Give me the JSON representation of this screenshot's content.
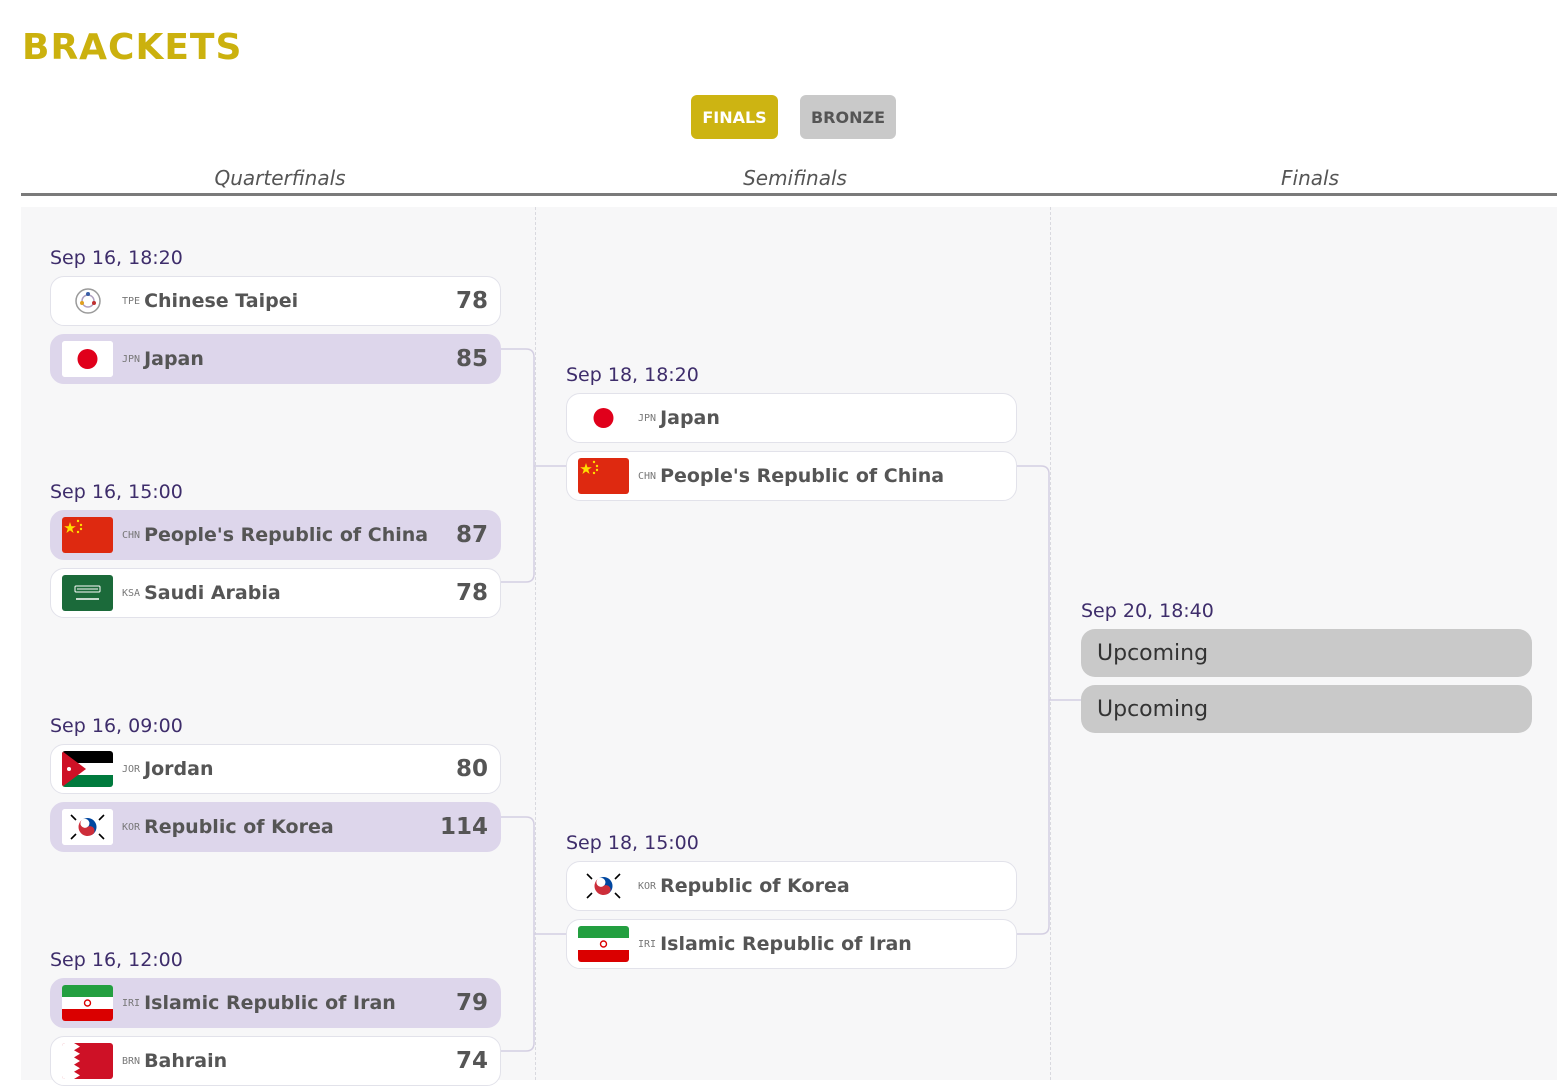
{
  "page": {
    "title": "BRACKETS"
  },
  "tabs": {
    "finals": "FINALS",
    "bronze": "BRONZE",
    "active": "FINALS"
  },
  "rounds": [
    "Quarterfinals",
    "Semifinals",
    "Finals"
  ],
  "colors": {
    "brand_gold": "#cdb412",
    "winner_highlight": "#ddd6eb",
    "date_text": "#3e2d6b",
    "upcoming_bg": "#c9c9c9"
  },
  "quarterfinals": [
    {
      "date": "Sep 16, 18:20",
      "teams": [
        {
          "code": "TPE",
          "name": "Chinese Taipei",
          "score": "78",
          "flag": "flag-chinese-taipei-icon",
          "winner": false
        },
        {
          "code": "JPN",
          "name": "Japan",
          "score": "85",
          "flag": "flag-japan-icon",
          "winner": true
        }
      ]
    },
    {
      "date": "Sep 16, 15:00",
      "teams": [
        {
          "code": "CHN",
          "name": "People's Republic of China",
          "score": "87",
          "flag": "flag-china-icon",
          "winner": true
        },
        {
          "code": "KSA",
          "name": "Saudi Arabia",
          "score": "78",
          "flag": "flag-saudi-arabia-icon",
          "winner": false
        }
      ]
    },
    {
      "date": "Sep 16, 09:00",
      "teams": [
        {
          "code": "JOR",
          "name": "Jordan",
          "score": "80",
          "flag": "flag-jordan-icon",
          "winner": false
        },
        {
          "code": "KOR",
          "name": "Republic of Korea",
          "score": "114",
          "flag": "flag-korea-icon",
          "winner": true
        }
      ]
    },
    {
      "date": "Sep 16, 12:00",
      "teams": [
        {
          "code": "IRI",
          "name": "Islamic Republic of Iran",
          "score": "79",
          "flag": "flag-iran-icon",
          "winner": true
        },
        {
          "code": "BRN",
          "name": "Bahrain",
          "score": "74",
          "flag": "flag-bahrain-icon",
          "winner": false
        }
      ]
    }
  ],
  "semifinals": [
    {
      "date": "Sep 18, 18:20",
      "teams": [
        {
          "code": "JPN",
          "name": "Japan",
          "score": "",
          "flag": "flag-japan-icon",
          "winner": false
        },
        {
          "code": "CHN",
          "name": "People's Republic of China",
          "score": "",
          "flag": "flag-china-icon",
          "winner": false
        }
      ]
    },
    {
      "date": "Sep 18, 15:00",
      "teams": [
        {
          "code": "KOR",
          "name": "Republic of Korea",
          "score": "",
          "flag": "flag-korea-icon",
          "winner": false
        },
        {
          "code": "IRI",
          "name": "Islamic Republic of Iran",
          "score": "",
          "flag": "flag-iran-icon",
          "winner": false
        }
      ]
    }
  ],
  "finals": {
    "date": "Sep 20, 18:40",
    "slots": [
      "Upcoming",
      "Upcoming"
    ]
  }
}
